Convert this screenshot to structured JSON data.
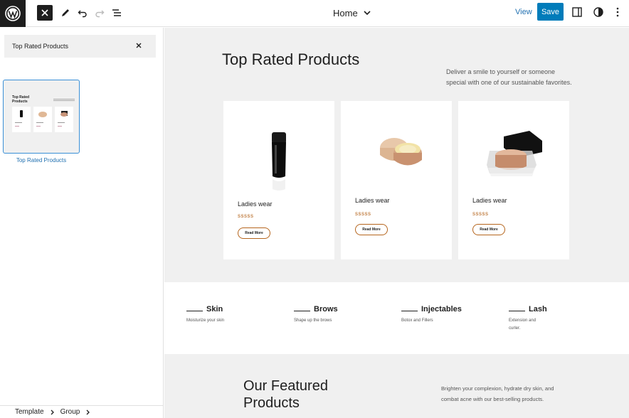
{
  "toolbar": {
    "document_title": "Home",
    "view_label": "View",
    "save_label": "Save"
  },
  "left_panel": {
    "search_value": "Top Rated Products",
    "pattern": {
      "label": "Top Rated Products",
      "preview_title": "Top Rated Products"
    },
    "breadcrumb": [
      "Template",
      "Group"
    ]
  },
  "canvas": {
    "top_rated": {
      "title": "Top Rated Products",
      "description": "Deliver a smile to yourself or someone special with one of our sustainable favorites.",
      "products": [
        {
          "name": "Ladies wear",
          "stars": "sssss",
          "button": "Read More"
        },
        {
          "name": "Ladies wear",
          "stars": "sssss",
          "button": "Read More"
        },
        {
          "name": "Ladies wear",
          "stars": "sssss",
          "button": "Read More"
        }
      ]
    },
    "features": [
      {
        "title": "Skin",
        "desc": "Moisturize your skin"
      },
      {
        "title": "Brows",
        "desc": "Shape up the brows"
      },
      {
        "title": "Injectables",
        "desc": "Botox and Fillers"
      },
      {
        "title": "Lash",
        "desc": "Extension and curler."
      }
    ],
    "featured": {
      "title": "Our Featured Products",
      "description": "Brighten your complexion, hydrate dry skin, and combat acne with our best-selling products."
    }
  },
  "colors": {
    "accent": "#007cba",
    "link": "#2271b1",
    "rating": "#b5651d",
    "canvas_bg": "#f0f0f0"
  },
  "icons": [
    "wordpress-logo-icon",
    "close-icon",
    "pen-icon",
    "undo-icon",
    "redo-icon",
    "list-view-icon",
    "chevron-down-icon",
    "settings-panel-icon",
    "styles-contrast-icon",
    "more-options-icon",
    "chevron-right-icon"
  ]
}
